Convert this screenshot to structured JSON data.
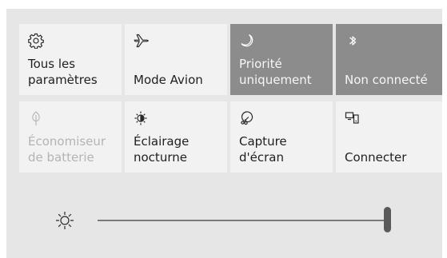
{
  "tiles": [
    {
      "label": "Tous les\nparamètres",
      "icon": "gear-icon",
      "state": "normal"
    },
    {
      "label": "Mode Avion",
      "icon": "airplane-icon",
      "state": "normal"
    },
    {
      "label": "Priorité\nuniquement",
      "icon": "moon-icon",
      "state": "active"
    },
    {
      "label": "Non connecté",
      "icon": "bluetooth-icon",
      "state": "active"
    },
    {
      "label": "Économiseur\nde batterie",
      "icon": "leaf-icon",
      "state": "disabled"
    },
    {
      "label": "Éclairage\nnocturne",
      "icon": "sun-moon-icon",
      "state": "normal"
    },
    {
      "label": "Capture\nd'écran",
      "icon": "snip-icon",
      "state": "normal"
    },
    {
      "label": "Connecter",
      "icon": "project-icon",
      "state": "normal"
    }
  ],
  "brightness": {
    "icon": "brightness-icon",
    "level": 1.0
  },
  "colors": {
    "panel": "#e6e6e6",
    "tile": "#f2f2f2",
    "tile_active": "#8c8c8c",
    "text": "#1f1f1f",
    "text_disabled": "#b4b4b4"
  }
}
